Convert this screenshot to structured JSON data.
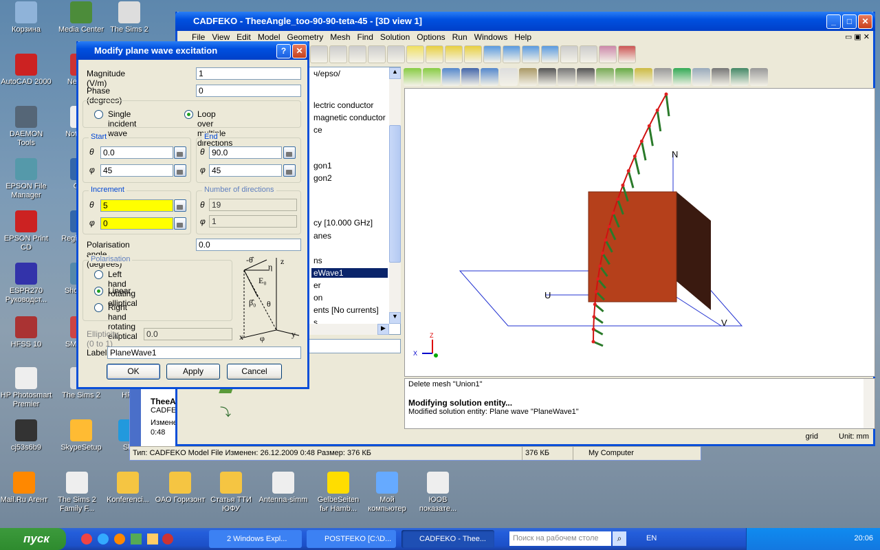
{
  "desktop": {
    "icons": [
      "Корзина",
      "Media Center",
      "The Sims 2",
      "AutoCAD 2000",
      "Ne Start",
      "DAEMON Tools",
      "Note Soft",
      "EPSON File Manager",
      "Quic",
      "EPSON Print CD",
      "Regist Note",
      "ESPR270 Руководст...",
      "Shop Sup",
      "HFSS 10",
      "SMAR To",
      "HP Photosmart Premier",
      "The Sims 2",
      "HFS",
      "cj53s6b9",
      "SkypeSetup",
      "Sky",
      "Mail.Ru Агент",
      "The Sims 2 Family F...",
      "Konferenci...",
      "ОАО Горизонт",
      "Статья ТТИ ЮФУ",
      "Antenna-simm",
      "GelbeSeiten fьr Hamb...",
      "Мой компьютер",
      "ЮОВ показате..."
    ]
  },
  "explorer": {
    "status_text": "Тип: CADFEKO Model File Изменен: 26.12.2009 0:48 Размер: 376 КБ",
    "size": "376 КБ",
    "location": "My Computer",
    "details_title": "TheeA",
    "details_type": "CADFE",
    "details_modified": "Изменен",
    "details_time": "0:48"
  },
  "cadfeko": {
    "title": "CADFEKO - TheeAngle_too-90-90-teta-45 - [3D view 1]",
    "menu": [
      "File",
      "View",
      "Edit",
      "Model",
      "Geometry",
      "Mesh",
      "Find",
      "Solution",
      "Options",
      "Run",
      "Windows",
      "Help"
    ],
    "tree": [
      "ч/ерsо/",
      "lectric conductor",
      "magnetic conductor",
      "ce",
      "gon1",
      "gon2",
      "cy [10.000 GHz]",
      "anes",
      "ns",
      "eWave1",
      "er",
      "on",
      "ents [No currents]",
      "s"
    ],
    "tree_selected": 9,
    "view_labels": {
      "n": "N",
      "u": "U",
      "v": "V",
      "axis_x": "X",
      "axis_z": "Z"
    },
    "messages": [
      "Delete mesh \"Union1\"",
      "Modifying solution entity...",
      "Modified solution entity: Plane wave \"PlaneWave1\""
    ],
    "status": {
      "grid": "grid",
      "unit": "Unit: mm"
    }
  },
  "dialog": {
    "title": "Modify plane wave excitation",
    "magnitude_label": "Magnitude (V/m)",
    "magnitude": "1",
    "phase_label": "Phase (degrees)",
    "phase": "0",
    "single_label": "Single incident wave",
    "loop_label": "Loop over multiple directions",
    "mode": "loop",
    "start_label": "Start",
    "end_label": "End",
    "increment_label": "Increment",
    "ndir_label": "Number of directions",
    "theta_sym": "θ",
    "phi_sym": "φ",
    "start_theta": "0.0",
    "start_phi": "45",
    "end_theta": "90.0",
    "end_phi": "45",
    "inc_theta": "5",
    "inc_phi": "0",
    "n_theta": "19",
    "n_phi": "1",
    "pol_angle_label": "Polarisation angle (degrees)",
    "pol_angle": "0.0",
    "pol_label": "Polarisation",
    "pol_options": [
      "Left hand rotating elliptical",
      "Linear",
      "Right hand rotating elliptical"
    ],
    "pol_selected": 1,
    "ellipticity_label": "Ellipticity (0 to 1)",
    "ellipticity": "0.0",
    "label_label": "Label",
    "label": "PlaneWave1",
    "ok": "OK",
    "apply": "Apply",
    "cancel": "Cancel",
    "diagram": {
      "theta_hat": "-θ̂",
      "eta": "η",
      "e0": "E₀",
      "beta": "β̂₀",
      "theta": "θ",
      "phi": "φ",
      "x": "x",
      "y": "y",
      "z": "z"
    }
  },
  "taskbar": {
    "start": "пуск",
    "tasks": [
      "2 Windows Expl...",
      "POSTFEKO [C:\\D...",
      "CADFEKO - Thee..."
    ],
    "search_placeholder": "Поиск на рабочем столе",
    "lang": "EN",
    "clock": "20:06"
  }
}
